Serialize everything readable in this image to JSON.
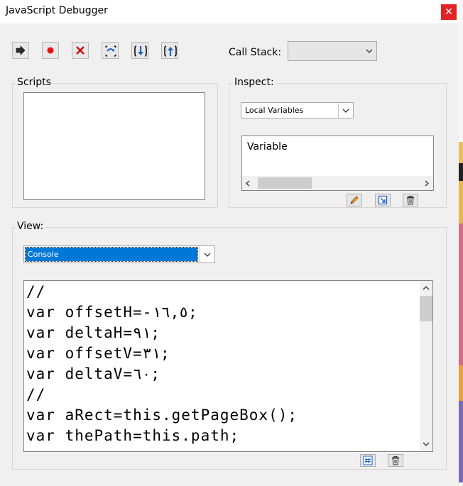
{
  "window": {
    "title": "JavaScript Debugger",
    "close_glyph": "✕"
  },
  "toolbar": {
    "buttons": [
      {
        "icon": "go-arrow-icon"
      },
      {
        "icon": "breakpoint-icon"
      },
      {
        "icon": "stop-icon"
      },
      {
        "icon": "step-over-icon"
      },
      {
        "icon": "step-into-icon"
      },
      {
        "icon": "step-out-icon"
      }
    ],
    "call_stack_label": "Call Stack:",
    "call_stack_value": ""
  },
  "scripts": {
    "label": "Scripts",
    "items": []
  },
  "inspect": {
    "label": "Inspect:",
    "selected": "Local Variables",
    "column_header": "Variable",
    "buttons": [
      {
        "icon": "pencil-icon"
      },
      {
        "icon": "watch-icon"
      },
      {
        "icon": "trash-icon"
      }
    ]
  },
  "view": {
    "label": "View:",
    "selected": "Console",
    "lines": [
      "//",
      "var offsetH=-١٦,٥;",
      "var deltaH=٩١;",
      "var offsetV=٣١;",
      "var deltaV=٦٠;",
      "//",
      "var aRect=this.getPageBox();",
      "var thePath=this.path;"
    ],
    "buttons": [
      {
        "icon": "hash-icon"
      },
      {
        "icon": "trash-icon"
      }
    ]
  },
  "colors": {
    "selection": "#0078d7",
    "close": "#e02424"
  }
}
